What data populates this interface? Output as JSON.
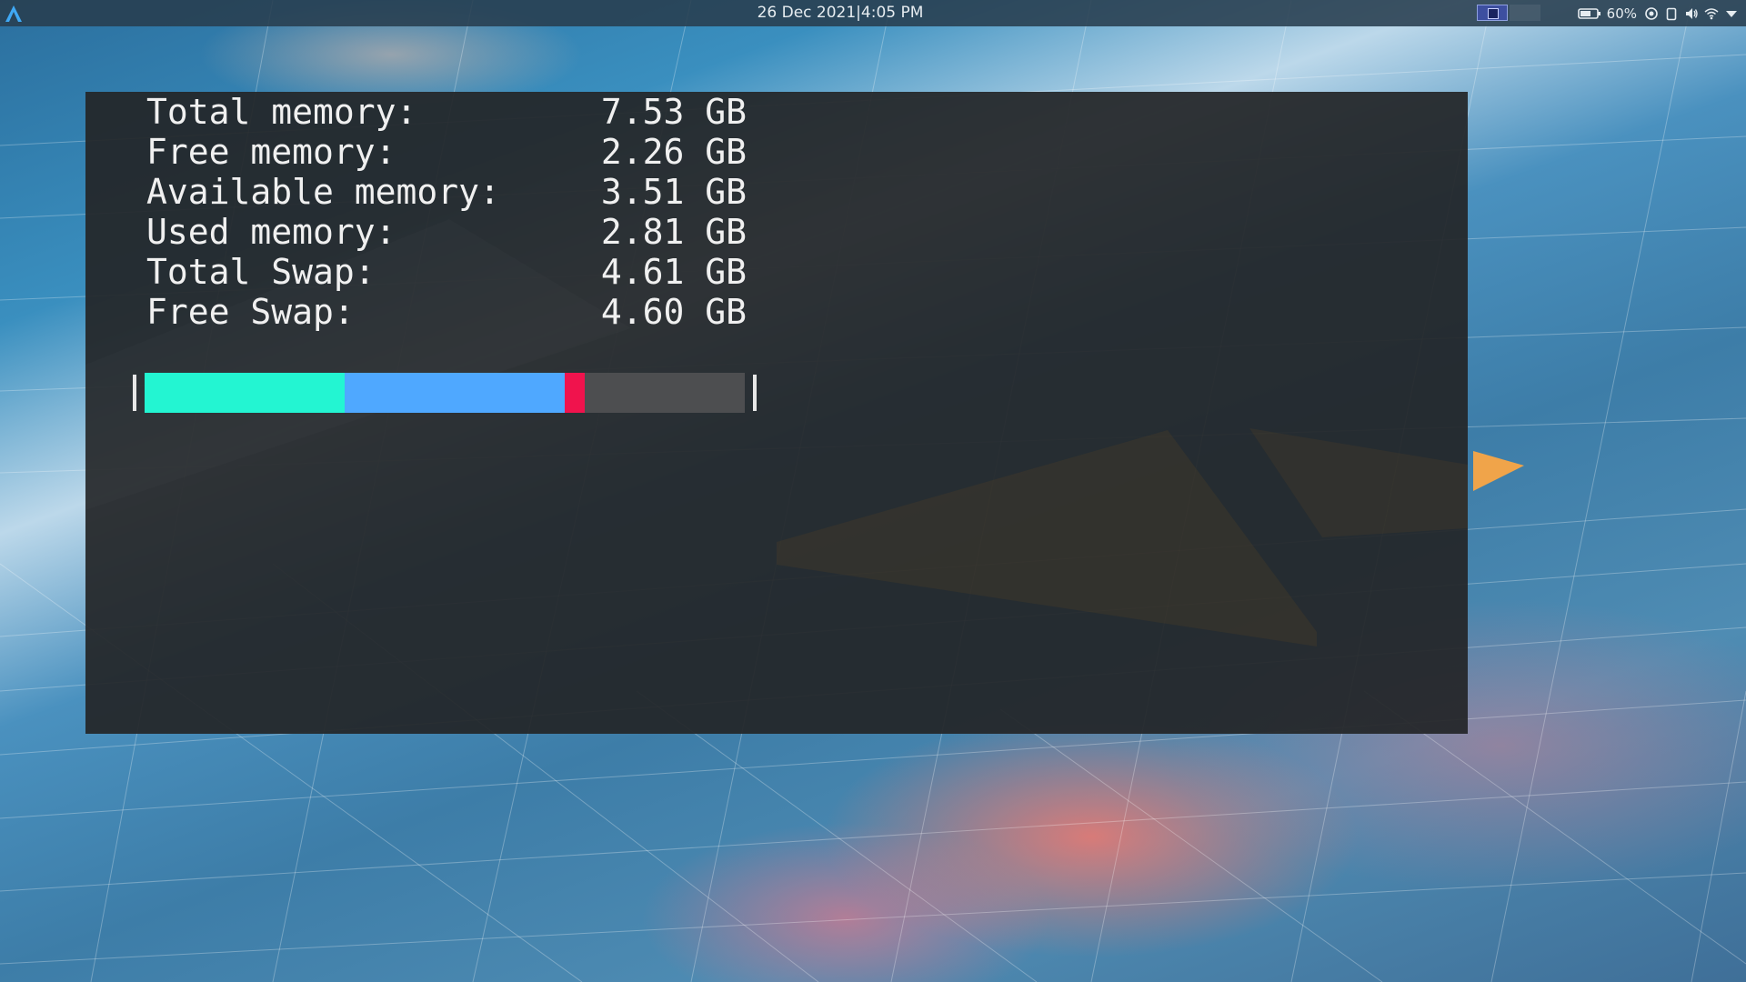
{
  "topbar": {
    "clock": "26 Dec 2021|4:05 PM",
    "battery_percent": "60%",
    "icons": [
      "launcher-icon",
      "workspace-indicator",
      "battery-icon",
      "night-light-icon",
      "clipboard-icon",
      "volume-icon",
      "wifi-icon",
      "chevron-down-icon"
    ]
  },
  "terminal": {
    "rows": [
      {
        "label": "Total memory:",
        "value": "7.53 GB"
      },
      {
        "label": "Free memory:",
        "value": "2.26 GB"
      },
      {
        "label": "Available memory:",
        "value": "3.51 GB"
      },
      {
        "label": "Used memory:",
        "value": "2.81 GB"
      },
      {
        "label": "Total Swap:",
        "value": "4.61 GB"
      },
      {
        "label": "Free Swap:",
        "value": "4.60 GB"
      }
    ],
    "bar": {
      "left_edge": "|",
      "right_edge": "|",
      "segments": [
        {
          "name": "used",
          "fraction": 0.333,
          "color": "#23f5d2"
        },
        {
          "name": "cached",
          "fraction": 0.367,
          "color": "#4fa8ff"
        },
        {
          "name": "swap",
          "fraction": 0.034,
          "color": "#f0134d"
        },
        {
          "name": "free",
          "fraction": 0.266,
          "color": "#4d4e50"
        }
      ]
    }
  }
}
